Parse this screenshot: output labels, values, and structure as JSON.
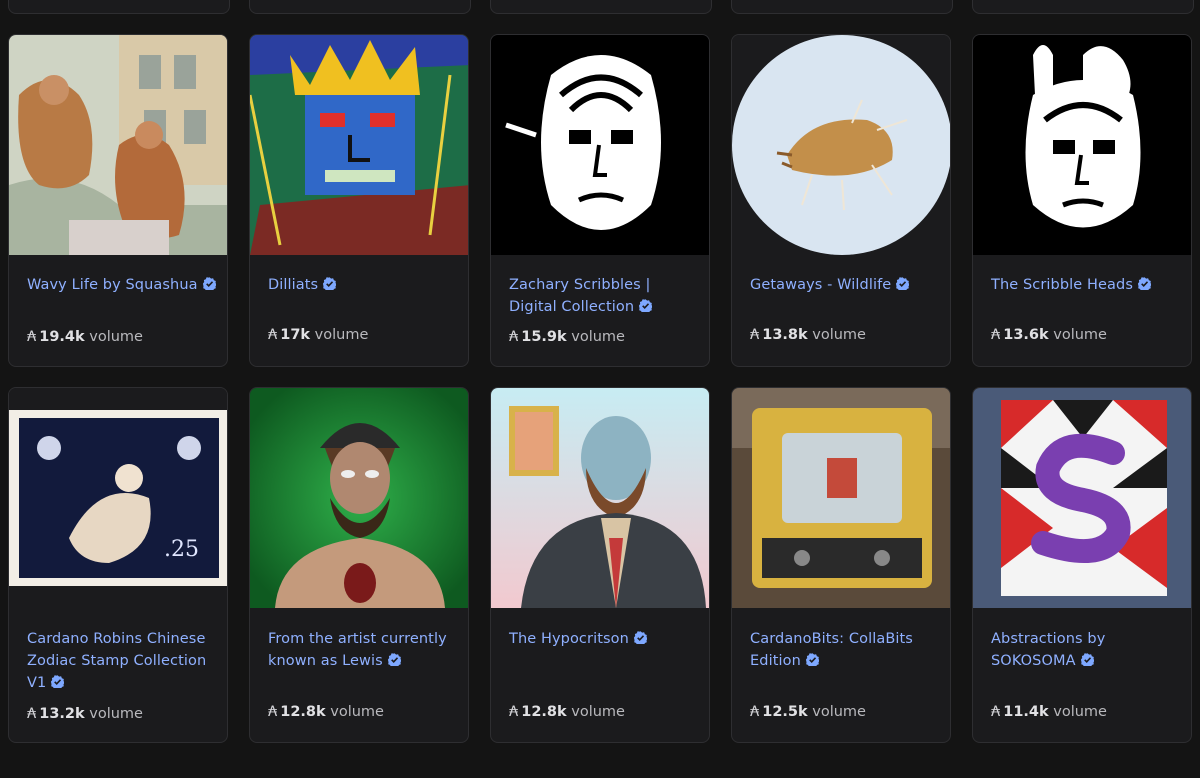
{
  "volume_suffix": "volume",
  "currency_symbol": "₳",
  "accent_color": "#8fb0ff",
  "verified_icon_color": "#7ea8ff",
  "collections": [
    {
      "name": "Wavy Life by Squashua",
      "verified": true,
      "volume": "19.4k",
      "image": "watercolor-monkeys"
    },
    {
      "name": "Dilliats",
      "verified": true,
      "volume": "17k",
      "image": "crowned-scribble-face"
    },
    {
      "name": "Zachary Scribbles | Digital Collection",
      "verified": true,
      "volume": "15.9k",
      "image": "scribble-face-pencil"
    },
    {
      "name": "Getaways - Wildlife",
      "verified": true,
      "volume": "13.8k",
      "image": "origami-beetle"
    },
    {
      "name": "The Scribble Heads",
      "verified": true,
      "volume": "13.6k",
      "image": "scribble-head-heart"
    },
    {
      "name": "Cardano Robins Chinese Zodiac Stamp Collection V1",
      "verified": true,
      "volume": "13.2k",
      "image": "zodiac-stamp"
    },
    {
      "name": "From the artist currently known as Lewis",
      "verified": true,
      "volume": "12.8k",
      "image": "bearded-man-beanie"
    },
    {
      "name": "The Hypocritson",
      "verified": true,
      "volume": "12.8k",
      "image": "zombie-man-glasses"
    },
    {
      "name": "CardanoBits: CollaBits Edition",
      "verified": true,
      "volume": "12.5k",
      "image": "retro-computer"
    },
    {
      "name": "Abstractions by SOKOSOMA",
      "verified": true,
      "volume": "11.4k",
      "image": "geometric-letter-s"
    }
  ]
}
